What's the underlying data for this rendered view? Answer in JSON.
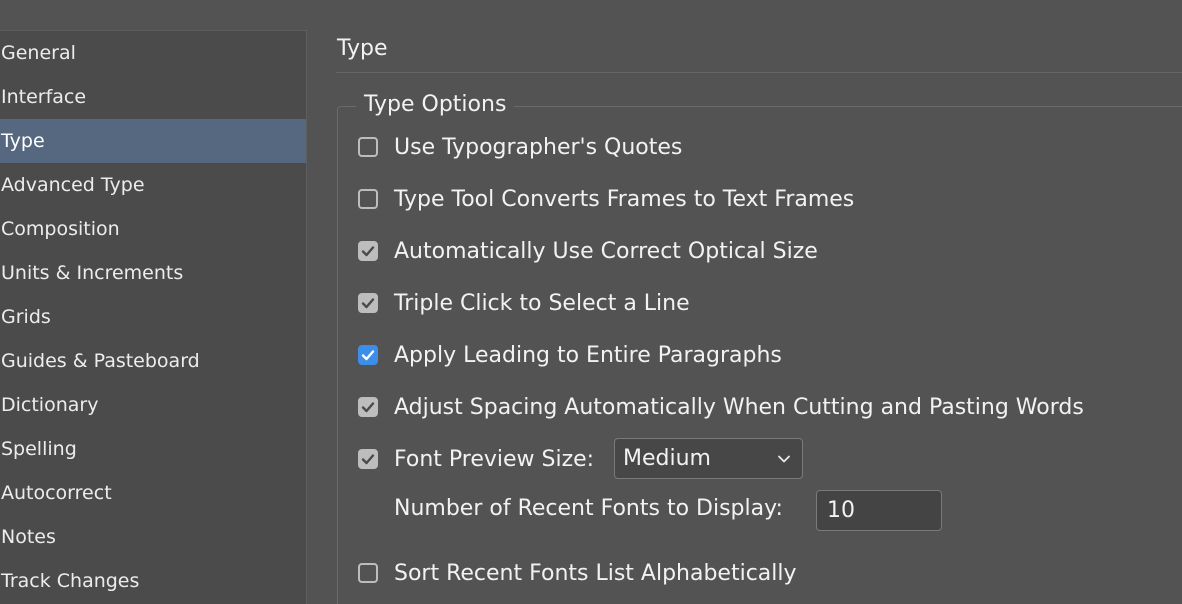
{
  "sidebar": {
    "items": [
      {
        "label": "General"
      },
      {
        "label": "Interface"
      },
      {
        "label": "Type"
      },
      {
        "label": "Advanced Type"
      },
      {
        "label": "Composition"
      },
      {
        "label": "Units & Increments"
      },
      {
        "label": "Grids"
      },
      {
        "label": "Guides & Pasteboard"
      },
      {
        "label": "Dictionary"
      },
      {
        "label": "Spelling"
      },
      {
        "label": "Autocorrect"
      },
      {
        "label": "Notes"
      },
      {
        "label": "Track Changes"
      }
    ],
    "selected": "Type"
  },
  "main": {
    "title": "Type",
    "group_title": "Type Options",
    "options": [
      {
        "label": "Use Typographer's Quotes",
        "checked": false
      },
      {
        "label": "Type Tool Converts Frames to Text Frames",
        "checked": false
      },
      {
        "label": "Automatically Use Correct Optical Size",
        "checked": true
      },
      {
        "label": "Triple Click to Select a Line",
        "checked": true
      },
      {
        "label": "Apply Leading to Entire Paragraphs",
        "checked": true
      },
      {
        "label": "Adjust Spacing Automatically When Cutting and Pasting Words",
        "checked": true
      },
      {
        "label": "Font Preview Size:",
        "checked": true
      },
      {
        "label": "Sort Recent Fonts List Alphabetically",
        "checked": false
      }
    ],
    "font_preview_size": {
      "value": "Medium"
    },
    "recent_fonts": {
      "label": "Number of Recent Fonts to Display:",
      "value": "10"
    }
  },
  "colors": {
    "background": "#535353",
    "sidebar_bg": "#4b4b4b",
    "selected_bg": "#56687f",
    "accent_checkbox": "#3d8ee8",
    "checkbox_gray": "#bdbdbd"
  },
  "icons": {
    "check": "checkmark-icon",
    "dropdown": "chevron-down-icon"
  }
}
